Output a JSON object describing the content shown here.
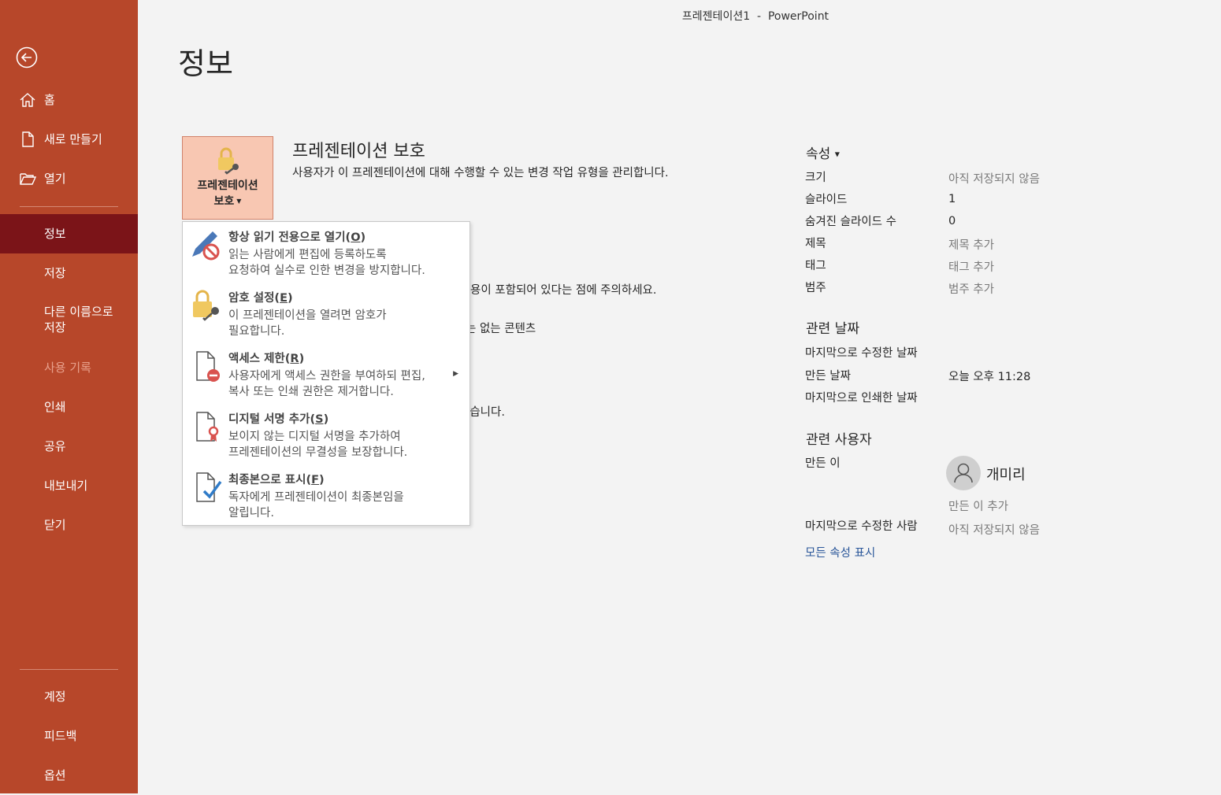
{
  "window": {
    "title": "프레젠테이션1  -  PowerPoint"
  },
  "page": {
    "title": "정보"
  },
  "nav": {
    "home": "홈",
    "new": "새로 만들기",
    "open": "열기",
    "info": "정보",
    "save": "저장",
    "save_as_1": "다른 이름으로",
    "save_as_2": "저장",
    "history": "사용 기록",
    "print": "인쇄",
    "share": "공유",
    "export": "내보내기",
    "close": "닫기",
    "account": "계정",
    "feedback": "피드백",
    "options": "옵션"
  },
  "protect": {
    "button_line1": "프레젠테이션",
    "button_line2": "보호",
    "title": "프레젠테이션 보호",
    "description": "사용자가 이 프레젠테이션에 대해 수행할 수 있는 변경 작업 유형을 관리합니다."
  },
  "background_text": {
    "line1": "용이 포함되어 있다는 점에 주의하세요.",
    "line2": "는 없는 콘텐츠",
    "line3": "었습니다."
  },
  "menu": [
    {
      "title": "항상 읽기 전용으로 열기",
      "key": "O",
      "desc1": "읽는 사람에게 편집에 등록하도록",
      "desc2": "요청하여 실수로 인한 변경을 방지합니다.",
      "icon": "pencil-no-icon"
    },
    {
      "title": "암호 설정",
      "key": "E",
      "desc1": "이 프레젠테이션을 열려면 암호가",
      "desc2": "필요합니다.",
      "icon": "lock-key-icon"
    },
    {
      "title": "액세스 제한",
      "key": "R",
      "desc1": "사용자에게 액세스 권한을 부여하되 편집,",
      "desc2": "복사 또는 인쇄 권한은 제거합니다.",
      "icon": "document-restrict-icon"
    },
    {
      "title": "디지털 서명 추가",
      "key": "S",
      "desc1": "보이지 않는 디지털 서명을 추가하여",
      "desc2": "프레젠테이션의 무결성을 보장합니다.",
      "icon": "document-ribbon-icon"
    },
    {
      "title": "최종본으로 표시",
      "key": "F",
      "desc1": "독자에게 프레젠테이션이 최종본임을",
      "desc2": "알립니다.",
      "icon": "document-check-icon"
    }
  ],
  "properties": {
    "header": "속성",
    "rows": [
      {
        "k": "크기",
        "v": "아직 저장되지 않음"
      },
      {
        "k": "슬라이드",
        "v": "1"
      },
      {
        "k": "숨겨진 슬라이드 수",
        "v": "0"
      },
      {
        "k": "제목",
        "v": "제목 추가"
      },
      {
        "k": "태그",
        "v": "태그 추가"
      },
      {
        "k": "범주",
        "v": "범주 추가"
      }
    ]
  },
  "dates": {
    "header": "관련 날짜",
    "modified": "마지막으로 수정한 날짜",
    "created": "만든 날짜",
    "created_value": "오늘 오후 11:28",
    "printed": "마지막으로 인쇄한 날짜"
  },
  "people": {
    "header": "관련 사용자",
    "author_label": "만든 이",
    "author_name": "개미리",
    "add_author": "만든 이 추가",
    "last_modified_by": "마지막으로 수정한 사람",
    "last_modified_value": "아직 저장되지 않음",
    "show_all": "모든 속성 표시"
  },
  "colors": {
    "sidebar": "#b7472a",
    "sidebar_active": "#7b1418",
    "link": "#2b579a"
  }
}
